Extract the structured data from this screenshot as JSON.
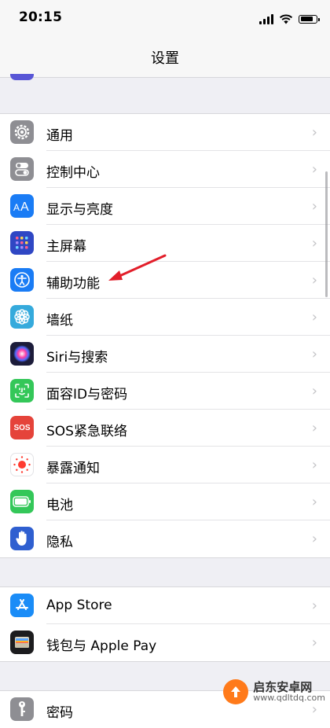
{
  "status_bar": {
    "time": "20:15"
  },
  "nav": {
    "title": "设置"
  },
  "group1": [
    {
      "label": "通用",
      "icon": "gear-icon",
      "color": "#8e8e93"
    },
    {
      "label": "控制中心",
      "icon": "toggles-icon",
      "color": "#8e8e93"
    },
    {
      "label": "显示与亮度",
      "icon": "text-size-icon",
      "color": "#1a7cf5"
    },
    {
      "label": "主屏幕",
      "icon": "home-grid-icon",
      "color": "#2f47c4"
    },
    {
      "label": "辅助功能",
      "icon": "accessibility-icon",
      "color": "#1a7cf5"
    },
    {
      "label": "墙纸",
      "icon": "flower-icon",
      "color": "#35aadc"
    },
    {
      "label": "Siri与搜索",
      "icon": "siri-icon",
      "color": "#1c1c3a"
    },
    {
      "label": "面容ID与密码",
      "icon": "face-id-icon",
      "color": "#34c759"
    },
    {
      "label": "SOS紧急联络",
      "icon": "sos-icon",
      "color": "#e5433a"
    },
    {
      "label": "暴露通知",
      "icon": "exposure-icon",
      "color": "#ffffff"
    },
    {
      "label": "电池",
      "icon": "battery-icon",
      "color": "#34c759"
    },
    {
      "label": "隐私",
      "icon": "hand-icon",
      "color": "#2f5fd0"
    }
  ],
  "group2": [
    {
      "label": "App Store",
      "icon": "app-store-icon",
      "color": "#1a8cf7"
    },
    {
      "label": "钱包与 Apple Pay",
      "icon": "wallet-icon",
      "color": "#1c1c1e"
    }
  ],
  "group3": [
    {
      "label": "密码",
      "icon": "key-icon",
      "color": "#8e8e93"
    }
  ],
  "sos_icon_text": "SOS",
  "watermark": {
    "title": "启东安卓网",
    "url": "www.qdltdq.com"
  }
}
